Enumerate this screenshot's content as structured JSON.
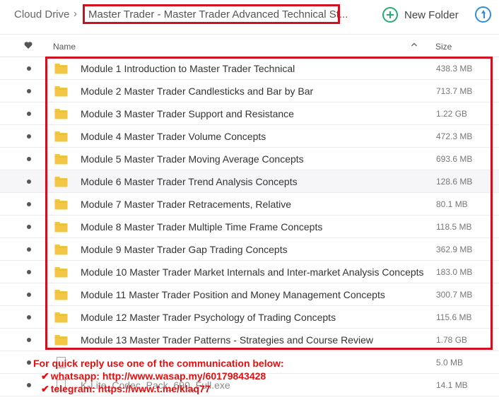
{
  "breadcrumb": {
    "root": "Cloud Drive",
    "separator": "›",
    "current": "Master Trader - Master Trader Advanced Technical St..."
  },
  "toolbar": {
    "new_folder_label": "New Folder",
    "new_folder_icon": "plus-circle-icon",
    "upload_icon": "upload-icon"
  },
  "columns": {
    "favorite_icon": "heart-icon",
    "name": "Name",
    "sort_icon": "caret-up-icon",
    "size": "Size"
  },
  "rows": [
    {
      "name": "Module 1 Introduction to Master Trader Technical",
      "size": "438.3 MB"
    },
    {
      "name": "Module 2 Master Trader Candlesticks and Bar by Bar",
      "size": "713.7 MB"
    },
    {
      "name": "Module 3 Master Trader Support and Resistance",
      "size": "1.22 GB"
    },
    {
      "name": "Module 4 Master Trader Volume Concepts",
      "size": "472.3 MB"
    },
    {
      "name": "Module 5 Master Trader Moving Average Concepts",
      "size": "693.6 MB"
    },
    {
      "name": "Module 6 Master Trader Trend Analysis Concepts",
      "size": "128.6 MB"
    },
    {
      "name": "Module 7 Master Trader Retracements, Relative",
      "size": "80.1 MB"
    },
    {
      "name": "Module 8 Master Trader Multiple Time Frame Concepts",
      "size": "118.5 MB"
    },
    {
      "name": "Module 9 Master Trader Gap Trading Concepts",
      "size": "362.9 MB"
    },
    {
      "name": "Module 10 Master Trader Market Internals and Inter-market Analysis Concepts",
      "size": "183.0 MB"
    },
    {
      "name": "Module 11 Master Trader Position and Money Management Concepts",
      "size": "300.7 MB"
    },
    {
      "name": "Module 12 Master Trader Psychology of Trading Concepts",
      "size": "115.6 MB"
    },
    {
      "name": "Module 13 Master Trader Patterns - Strategies and Course Review",
      "size": "1.78 GB"
    },
    {
      "name": "",
      "size": "5.0 MB"
    },
    {
      "name": "K-Lite_Codec_Pack_690_Full.exe",
      "size": "14.1 MB"
    }
  ],
  "overlay": {
    "line1": "For quick reply use one of the communication below:",
    "line2": "whatsapp: http://www.wasap.my/60179843428",
    "line3": "telegram: https://www.t.me/klaq77"
  },
  "colors": {
    "highlight_box": "#d0101e",
    "new_folder": "#2aa876",
    "upload": "#2f8fd6",
    "folder": "#f2c744",
    "overlay_text": "#e01010"
  }
}
